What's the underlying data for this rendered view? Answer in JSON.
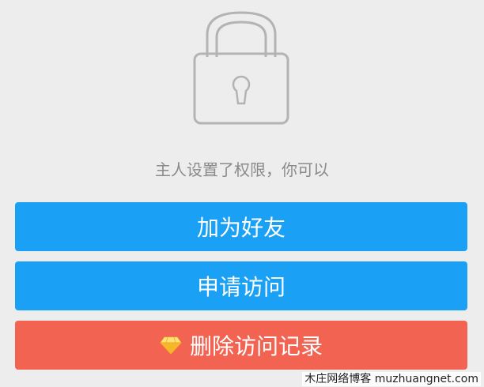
{
  "message": "主人设置了权限，你可以",
  "buttons": {
    "add_friend": "加为好友",
    "request_access": "申请访问",
    "delete_record": "删除访问记录"
  },
  "icons": {
    "lock": "lock-icon",
    "diamond": "diamond-icon"
  },
  "colors": {
    "primary": "#1aa1f5",
    "danger": "#f36352",
    "background": "#ededed",
    "message_text": "#8a8a8a"
  },
  "watermark": "木庄网络博客 muzhuangnet.com"
}
